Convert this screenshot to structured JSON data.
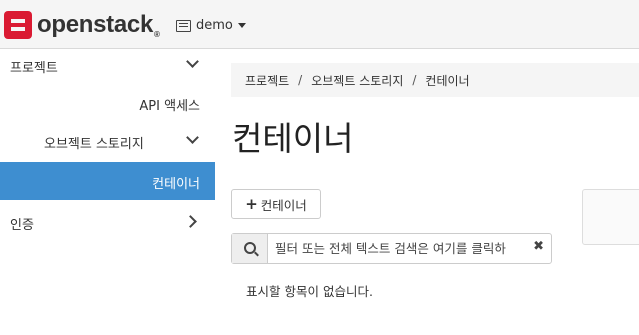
{
  "navbar": {
    "logo_text": "openstack",
    "logo_tm": "®",
    "project_name": "demo"
  },
  "sidebar": {
    "items": [
      {
        "label": "프로젝트"
      },
      {
        "label": "API 액세스"
      },
      {
        "label": "오브젝트 스토리지"
      },
      {
        "label": "컨테이너"
      },
      {
        "label": "인증"
      }
    ]
  },
  "breadcrumb": {
    "items": [
      "프로젝트",
      "오브젝트 스토리지",
      "컨테이너"
    ],
    "separator": "/"
  },
  "page": {
    "title": "컨테이너",
    "create_button_label": "컨테이너",
    "create_button_icon": "+",
    "search_placeholder": "필터 또는 전체 텍스트 검색은 여기를 클릭하",
    "clear_icon": "✖",
    "empty_message": "표시할 항목이 없습니다."
  },
  "colors": {
    "brand": "#da1a32",
    "active": "#3e8ed0"
  },
  "icons": [
    "openstack-logo-icon",
    "project-icon",
    "caret-down-icon",
    "chevron-down-icon",
    "chevron-right-icon",
    "plus-icon",
    "search-icon",
    "clear-icon"
  ]
}
